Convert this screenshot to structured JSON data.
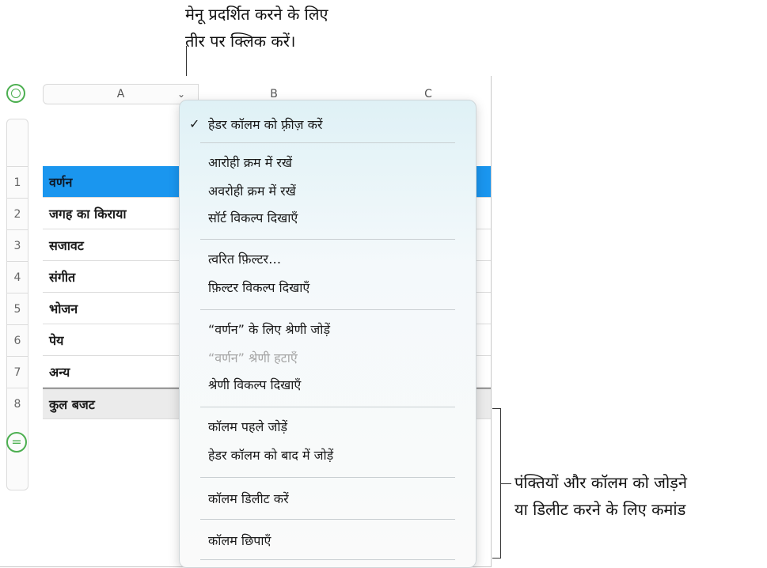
{
  "callouts": {
    "top_line1": "मेनू प्रदर्शित करने के लिए",
    "top_line2": "तीर पर क्लिक करें।",
    "right_line1": "पंक्तियों और कॉलम को जोड़ने",
    "right_line2": "या डिलीट करने के लिए कमांड"
  },
  "columns": {
    "a": "A",
    "b": "B",
    "c": "C"
  },
  "rows": [
    {
      "num": "1",
      "label": "वर्णन"
    },
    {
      "num": "2",
      "label": "जगह का किराया"
    },
    {
      "num": "3",
      "label": "सजावट"
    },
    {
      "num": "4",
      "label": "संगीत"
    },
    {
      "num": "5",
      "label": "भोजन"
    },
    {
      "num": "6",
      "label": "पेय"
    },
    {
      "num": "7",
      "label": "अन्य"
    },
    {
      "num": "8",
      "label": "कुल बजट"
    }
  ],
  "menu": {
    "freeze": "हेडर कॉलम को फ़्रीज़ करें",
    "sort_asc": "आरोही क्रम में रखें",
    "sort_desc": "अवरोही क्रम में रखें",
    "sort_opts": "सॉर्ट विकल्प दिखाएँ",
    "quick_filter": "त्वरित फ़िल्टर…",
    "filter_opts": "फ़िल्टर विकल्प दिखाएँ",
    "add_cat": "“वर्णन” के लिए श्रेणी जोड़ें",
    "remove_cat": "“वर्णन” श्रेणी हटाएँ",
    "cat_opts": "श्रेणी विकल्प दिखाएँ",
    "add_before": "कॉलम पहले जोड़ें",
    "add_after": "हेडर कॉलम को बाद में जोड़ें",
    "delete_col": "कॉलम डिलीट करें",
    "hide_col": "कॉलम छिपाएँ"
  },
  "colors": {
    "header_row": "#1a96ef",
    "accent_green": "#4caf50"
  }
}
